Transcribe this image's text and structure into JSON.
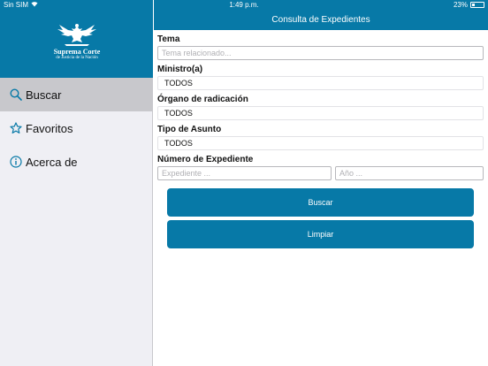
{
  "status_bar": {
    "carrier": "Sin SIM",
    "time": "1:49 p.m.",
    "battery": "23%"
  },
  "sidebar": {
    "logo": {
      "title": "Suprema Corte",
      "subtitle": "de Justicia de la Nación"
    },
    "items": [
      {
        "label": "Buscar",
        "icon": "search-icon"
      },
      {
        "label": "Favoritos",
        "icon": "star-icon"
      },
      {
        "label": "Acerca de",
        "icon": "info-icon"
      }
    ]
  },
  "header": {
    "title": "Consulta de Expedientes"
  },
  "form": {
    "tema": {
      "label": "Tema",
      "placeholder": "Tema relacionado..."
    },
    "ministro": {
      "label": "Ministro(a)",
      "value": "TODOS"
    },
    "organo": {
      "label": "Órgano de radicación",
      "value": "TODOS"
    },
    "tipo": {
      "label": "Tipo de Asunto",
      "value": "TODOS"
    },
    "expediente": {
      "label": "Número de Expediente",
      "expediente_placeholder": "Expediente ...",
      "anio_placeholder": "Año ..."
    }
  },
  "buttons": {
    "buscar": "Buscar",
    "limpiar": "Limpiar"
  },
  "colors": {
    "accent": "#0779a7",
    "sidebar_bg": "#efeff4",
    "selected_bg": "#c8c8cc"
  }
}
